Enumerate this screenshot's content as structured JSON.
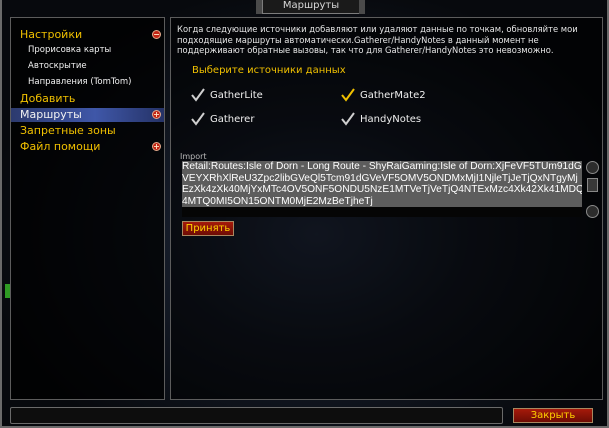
{
  "window": {
    "title": "Маршруты"
  },
  "sidebar": {
    "items": [
      {
        "label": "Настройки",
        "toggle": "−"
      },
      {
        "label": "Прорисовка карты"
      },
      {
        "label": "Автоскрытие"
      },
      {
        "label": "Направления (TomTom)"
      },
      {
        "label": "Добавить"
      },
      {
        "label": "Маршруты",
        "toggle": "+"
      },
      {
        "label": "Запретные зоны"
      },
      {
        "label": "Файл помощи",
        "toggle": "+"
      }
    ]
  },
  "main": {
    "description": "Когда следующие источники добавляют или удаляют данные по точкам, обновляйте мои подходящие маршруты автоматически.Gatherer/HandyNotes в данный момент не поддерживают обратные вызовы, так что для Gatherer/HandyNotes это невозможно.",
    "sources_heading": "Выберите источники данных",
    "sources": [
      {
        "label": "GatherLite",
        "checked": true,
        "check_color": "#cfcfcf"
      },
      {
        "label": "GatherMate2",
        "checked": true,
        "check_color": "#f0c000"
      },
      {
        "label": "Gatherer",
        "checked": true,
        "check_color": "#cfcfcf"
      },
      {
        "label": "HandyNotes",
        "checked": true,
        "check_color": "#cfcfcf"
      }
    ],
    "import_label": "Import",
    "import_value": "Retail:Routes:Isle of Dorn - Long Route - ShyRaiGaming:Isle of Dorn:XjFeVF5TUm91dGVEYXRhXlReU3Zpc2libGVeQl5Tcm91dGVeVF5OMV5ONDMxMjI1NjleTjJeTjQxNTgyMjEzXk4zXk40MjYxMTc4OV5ONF5ONDU5NzE1MTVeTjVeTjQ4NTExMzc4Xk42Xk41MDQ4MTQ0MI5ON15ONTM0MjE2MzBeTjheTj",
    "apply_label": "Принять"
  },
  "footer": {
    "close_label": "Закрыть"
  },
  "colors": {
    "accent": "#f0c000",
    "button_red": "#8e1406",
    "selected": "#3a4f9c"
  }
}
